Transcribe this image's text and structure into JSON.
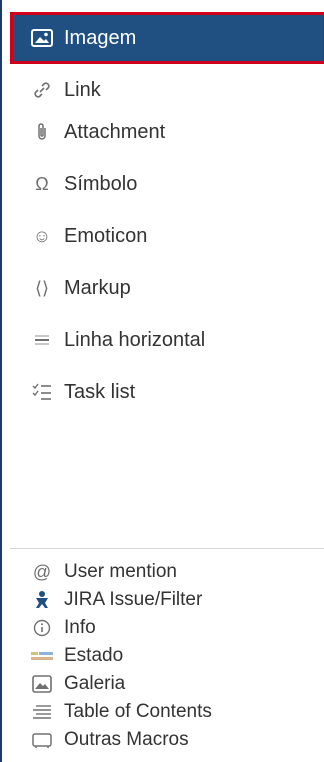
{
  "menu": {
    "section1": [
      {
        "label": "Imagem",
        "icon": "image-icon",
        "selected": true
      },
      {
        "label": "Link",
        "icon": "link-icon"
      },
      {
        "label": "Attachment",
        "icon": "paperclip-icon"
      },
      {
        "label": "Símbolo",
        "icon": "omega-icon"
      },
      {
        "label": "Emoticon",
        "icon": "smiley-icon"
      },
      {
        "label": "Markup",
        "icon": "code-brackets-icon"
      },
      {
        "label": "Linha horizontal",
        "icon": "horizontal-rule-icon"
      },
      {
        "label": "Task list",
        "icon": "task-list-icon"
      }
    ],
    "section2": [
      {
        "label": "User mention",
        "icon": "at-icon"
      },
      {
        "label": "JIRA Issue/Filter",
        "icon": "jira-icon"
      },
      {
        "label": "Info",
        "icon": "info-icon"
      },
      {
        "label": "Estado",
        "icon": "status-icon"
      },
      {
        "label": "Galeria",
        "icon": "gallery-icon"
      },
      {
        "label": "Table of Contents",
        "icon": "toc-icon"
      },
      {
        "label": "Outras Macros",
        "icon": "macros-icon"
      }
    ]
  },
  "colors": {
    "selected_bg": "#205081",
    "selected_border": "#d0021b",
    "text": "#333333",
    "icon": "#707070"
  }
}
